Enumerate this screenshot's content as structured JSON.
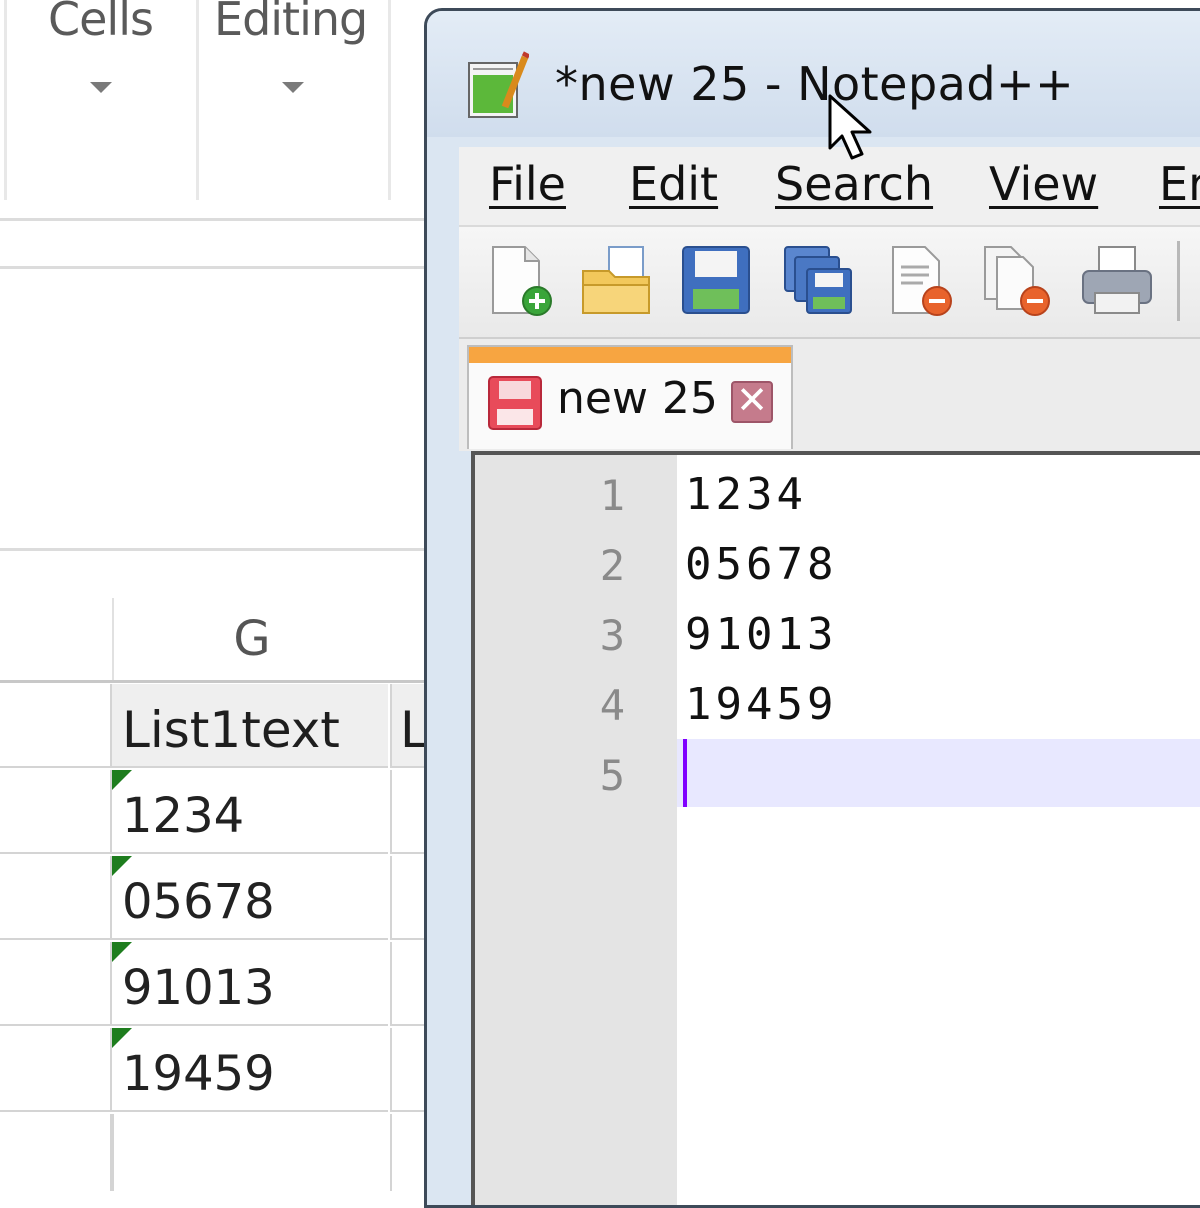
{
  "excel": {
    "ribbon_groups": [
      {
        "label": "Cells"
      },
      {
        "label": "Editing"
      }
    ],
    "column_header": "G",
    "next_column_partial": "L",
    "cells": [
      "List1text",
      "1234",
      "05678",
      "91013",
      "19459"
    ],
    "colors": {
      "text_indicator": "#1e7d1e"
    }
  },
  "notepadpp": {
    "title": "*new 25 - Notepad++",
    "menu": [
      {
        "label": "File"
      },
      {
        "label": "Edit"
      },
      {
        "label": "Search"
      },
      {
        "label": "View"
      },
      {
        "label": "Er"
      }
    ],
    "toolbar": [
      {
        "icon": "new-file-icon"
      },
      {
        "icon": "open-folder-icon"
      },
      {
        "icon": "save-icon"
      },
      {
        "icon": "save-all-icon"
      },
      {
        "icon": "close-icon"
      },
      {
        "icon": "close-all-icon"
      },
      {
        "icon": "print-icon"
      }
    ],
    "tab": {
      "label": "new 25",
      "close_glyph": "✕"
    },
    "lines": [
      {
        "num": "1",
        "text": "1234"
      },
      {
        "num": "2",
        "text": "05678"
      },
      {
        "num": "3",
        "text": "91013"
      },
      {
        "num": "4",
        "text": "19459"
      },
      {
        "num": "5",
        "text": ""
      }
    ],
    "colors": {
      "tab_accent": "#f7a541",
      "caret": "#8000ff",
      "current_line": "#e8e8ff"
    }
  }
}
